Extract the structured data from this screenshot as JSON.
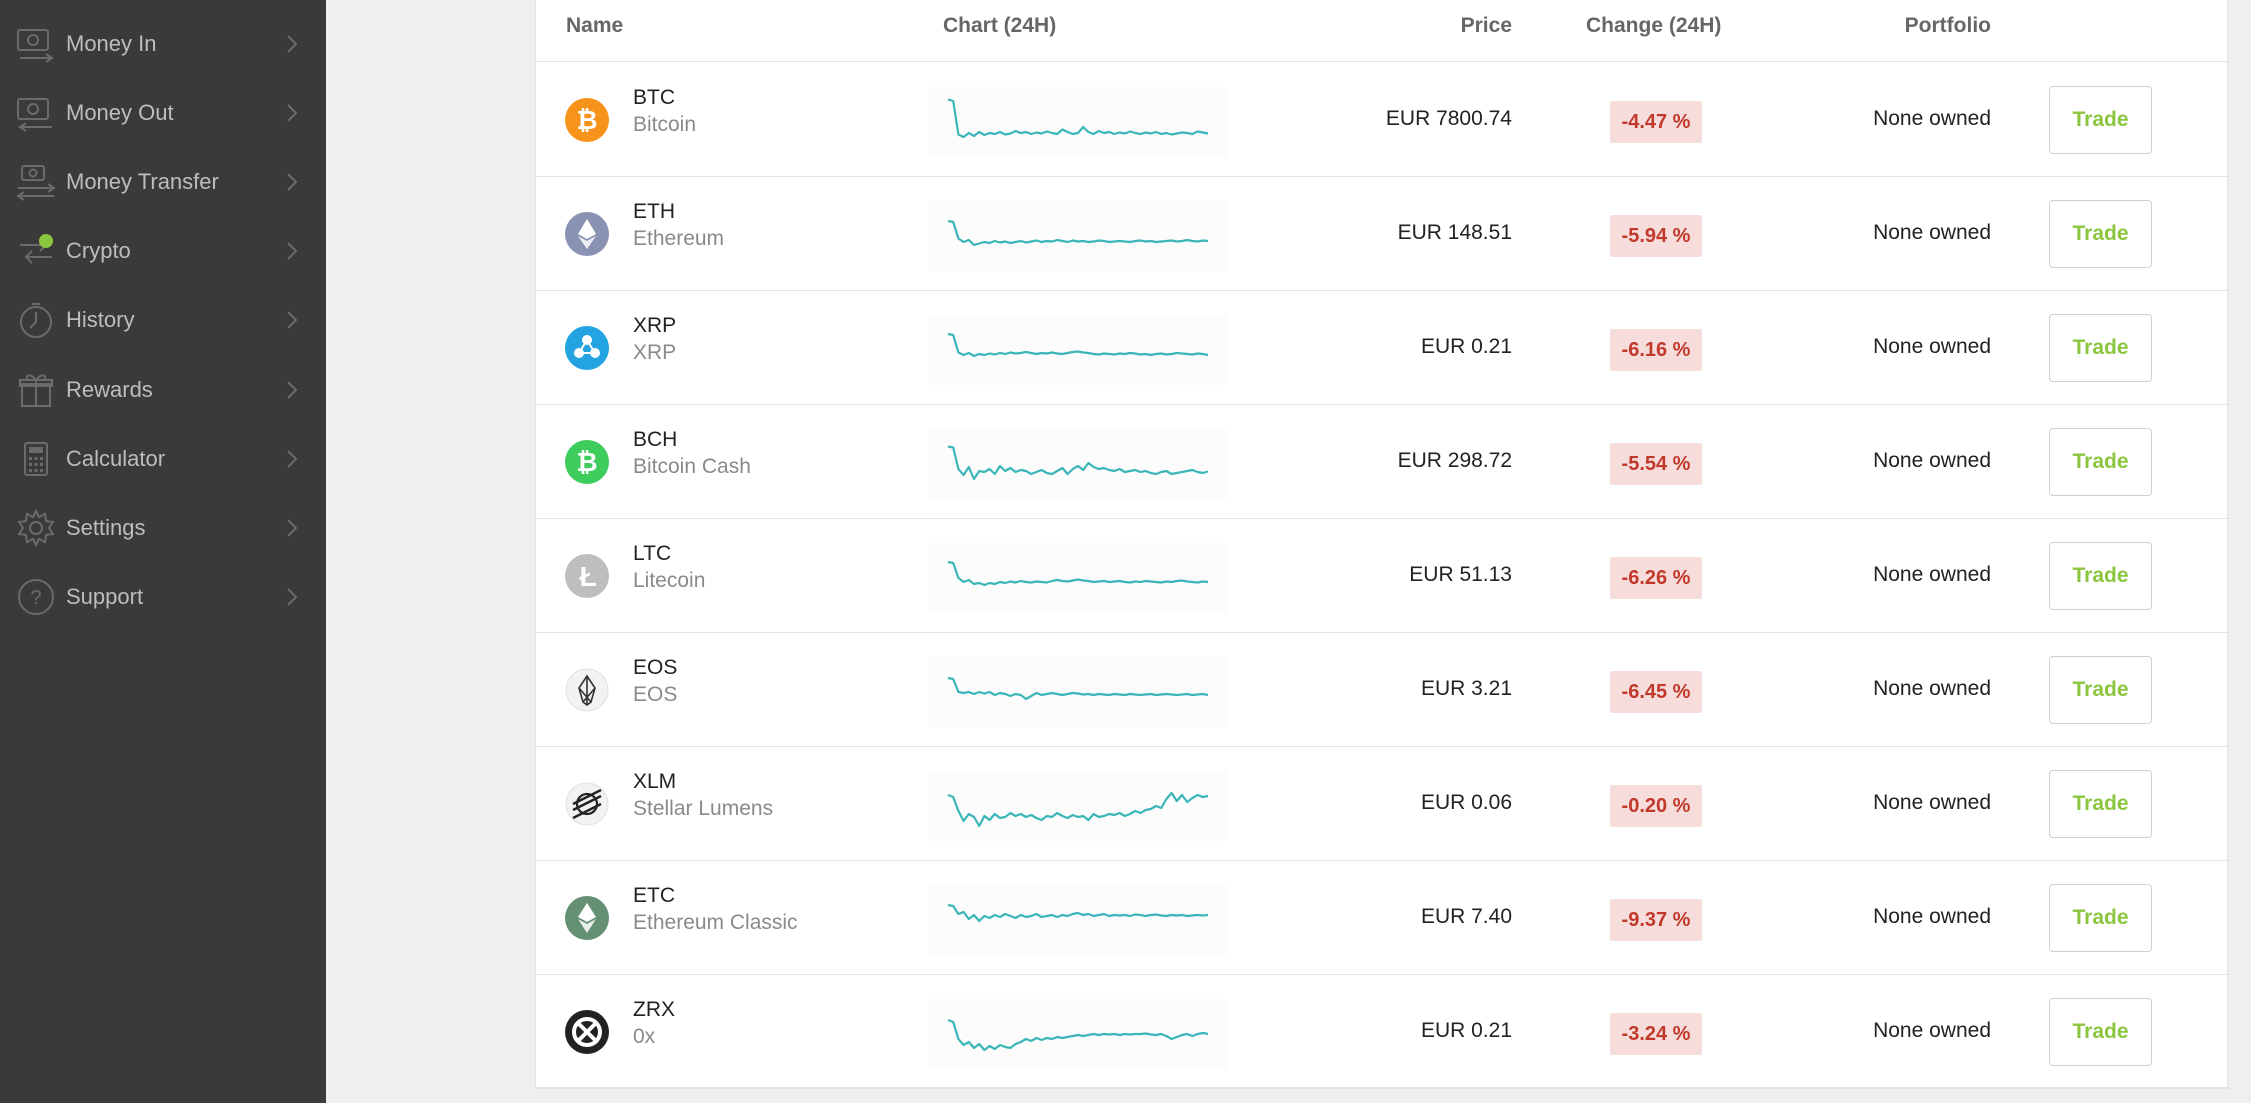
{
  "sidebar": {
    "items": [
      {
        "label": "Money In",
        "icon": "money-in-icon"
      },
      {
        "label": "Money Out",
        "icon": "money-out-icon"
      },
      {
        "label": "Money Transfer",
        "icon": "money-transfer-icon"
      },
      {
        "label": "Crypto",
        "icon": "crypto-icon",
        "badge_color": "#8cc63f"
      },
      {
        "label": "History",
        "icon": "history-icon"
      },
      {
        "label": "Rewards",
        "icon": "rewards-icon"
      },
      {
        "label": "Calculator",
        "icon": "calculator-icon"
      },
      {
        "label": "Settings",
        "icon": "settings-icon"
      },
      {
        "label": "Support",
        "icon": "support-icon"
      }
    ]
  },
  "table": {
    "headers": {
      "name": "Name",
      "chart": "Chart (24H)",
      "price": "Price",
      "change": "Change (24H)",
      "portfolio": "Portfolio"
    },
    "rows": [
      {
        "symbol": "BTC",
        "name": "Bitcoin",
        "price": "EUR 7800.74",
        "change": "-4.47 %",
        "portfolio": "None owned",
        "action": "Trade",
        "logo_color": "#f7931a",
        "logo_icon": "bitcoin-icon",
        "spark": [
          0.95,
          0.92,
          0.25,
          0.2,
          0.28,
          0.22,
          0.3,
          0.24,
          0.28,
          0.26,
          0.3,
          0.25,
          0.27,
          0.32,
          0.28,
          0.3,
          0.26,
          0.29,
          0.27,
          0.31,
          0.28,
          0.26,
          0.35,
          0.3,
          0.26,
          0.28,
          0.4,
          0.3,
          0.26,
          0.32,
          0.28,
          0.3,
          0.26,
          0.29,
          0.27,
          0.31,
          0.28,
          0.26,
          0.29,
          0.27,
          0.3,
          0.26,
          0.28,
          0.25,
          0.27,
          0.29,
          0.28,
          0.26,
          0.31,
          0.29,
          0.27
        ]
      },
      {
        "symbol": "ETH",
        "name": "Ethereum",
        "price": "EUR 148.51",
        "change": "-5.94 %",
        "portfolio": "None owned",
        "action": "Trade",
        "logo_color": "#8a92b2",
        "logo_icon": "ethereum-icon",
        "spark": [
          0.8,
          0.78,
          0.45,
          0.38,
          0.42,
          0.32,
          0.35,
          0.38,
          0.36,
          0.4,
          0.37,
          0.39,
          0.36,
          0.38,
          0.4,
          0.37,
          0.39,
          0.41,
          0.38,
          0.4,
          0.39,
          0.42,
          0.4,
          0.38,
          0.41,
          0.39,
          0.4,
          0.38,
          0.39,
          0.41,
          0.4,
          0.38,
          0.39,
          0.4,
          0.39,
          0.38,
          0.4,
          0.41,
          0.39,
          0.4,
          0.38,
          0.39,
          0.4,
          0.41,
          0.39,
          0.4,
          0.42,
          0.4,
          0.39,
          0.41,
          0.4
        ]
      },
      {
        "symbol": "XRP",
        "name": "XRP",
        "price": "EUR 0.21",
        "change": "-6.16 %",
        "portfolio": "None owned",
        "action": "Trade",
        "logo_color": "#23a3e0",
        "logo_icon": "xrp-icon",
        "spark": [
          0.82,
          0.8,
          0.45,
          0.4,
          0.44,
          0.38,
          0.42,
          0.4,
          0.43,
          0.41,
          0.44,
          0.42,
          0.45,
          0.43,
          0.44,
          0.46,
          0.44,
          0.42,
          0.44,
          0.43,
          0.45,
          0.43,
          0.42,
          0.44,
          0.46,
          0.47,
          0.45,
          0.44,
          0.42,
          0.41,
          0.43,
          0.42,
          0.41,
          0.43,
          0.42,
          0.44,
          0.43,
          0.41,
          0.42,
          0.4,
          0.42,
          0.43,
          0.41,
          0.42,
          0.44,
          0.43,
          0.42,
          0.41,
          0.43,
          0.42,
          0.4
        ]
      },
      {
        "symbol": "BCH",
        "name": "Bitcoin Cash",
        "price": "EUR 298.72",
        "change": "-5.54 %",
        "portfolio": "None owned",
        "action": "Trade",
        "logo_color": "#3ecc5c",
        "logo_icon": "bitcoin-cash-icon",
        "spark": [
          0.85,
          0.83,
          0.4,
          0.28,
          0.44,
          0.2,
          0.36,
          0.34,
          0.4,
          0.3,
          0.46,
          0.36,
          0.42,
          0.34,
          0.38,
          0.36,
          0.3,
          0.34,
          0.38,
          0.32,
          0.3,
          0.36,
          0.42,
          0.3,
          0.4,
          0.46,
          0.38,
          0.52,
          0.44,
          0.4,
          0.42,
          0.38,
          0.36,
          0.4,
          0.34,
          0.36,
          0.38,
          0.34,
          0.36,
          0.32,
          0.3,
          0.34,
          0.36,
          0.3,
          0.32,
          0.34,
          0.36,
          0.38,
          0.34,
          0.32,
          0.35
        ]
      },
      {
        "symbol": "LTC",
        "name": "Litecoin",
        "price": "EUR 51.13",
        "change": "-6.26 %",
        "portfolio": "None owned",
        "action": "Trade",
        "logo_color": "#bebebe",
        "logo_icon": "litecoin-icon",
        "spark": [
          0.82,
          0.8,
          0.5,
          0.42,
          0.46,
          0.38,
          0.4,
          0.36,
          0.4,
          0.38,
          0.42,
          0.4,
          0.43,
          0.41,
          0.44,
          0.42,
          0.41,
          0.43,
          0.42,
          0.41,
          0.44,
          0.46,
          0.44,
          0.43,
          0.45,
          0.47,
          0.45,
          0.44,
          0.42,
          0.43,
          0.44,
          0.42,
          0.43,
          0.44,
          0.42,
          0.41,
          0.43,
          0.42,
          0.44,
          0.43,
          0.42,
          0.41,
          0.43,
          0.42,
          0.44,
          0.45,
          0.43,
          0.42,
          0.41,
          0.43,
          0.42
        ]
      },
      {
        "symbol": "EOS",
        "name": "EOS",
        "price": "EUR 3.21",
        "change": "-6.45 %",
        "portfolio": "None owned",
        "action": "Trade",
        "logo_color": "#f2f2f2",
        "logo_icon": "eos-icon",
        "spark": [
          0.78,
          0.76,
          0.5,
          0.48,
          0.5,
          0.46,
          0.5,
          0.47,
          0.5,
          0.44,
          0.48,
          0.46,
          0.42,
          0.46,
          0.44,
          0.36,
          0.42,
          0.48,
          0.44,
          0.46,
          0.48,
          0.46,
          0.44,
          0.46,
          0.48,
          0.47,
          0.45,
          0.46,
          0.44,
          0.46,
          0.45,
          0.44,
          0.46,
          0.45,
          0.44,
          0.46,
          0.45,
          0.44,
          0.45,
          0.46,
          0.44,
          0.45,
          0.46,
          0.45,
          0.44,
          0.45,
          0.46,
          0.44,
          0.45,
          0.46,
          0.44
        ]
      },
      {
        "symbol": "XLM",
        "name": "Stellar Lumens",
        "price": "EUR 0.06",
        "change": "-0.20 %",
        "portfolio": "None owned",
        "action": "Trade",
        "logo_color": "#f2f2f2",
        "logo_icon": "stellar-icon",
        "spark": [
          0.72,
          0.68,
          0.4,
          0.2,
          0.34,
          0.28,
          0.1,
          0.3,
          0.22,
          0.34,
          0.26,
          0.28,
          0.36,
          0.3,
          0.34,
          0.28,
          0.32,
          0.26,
          0.22,
          0.3,
          0.28,
          0.36,
          0.3,
          0.26,
          0.32,
          0.28,
          0.3,
          0.22,
          0.34,
          0.28,
          0.3,
          0.34,
          0.32,
          0.36,
          0.3,
          0.34,
          0.4,
          0.36,
          0.42,
          0.44,
          0.5,
          0.46,
          0.64,
          0.76,
          0.6,
          0.72,
          0.58,
          0.66,
          0.72,
          0.68,
          0.7
        ]
      },
      {
        "symbol": "ETC",
        "name": "Ethereum Classic",
        "price": "EUR 7.40",
        "change": "-9.37 %",
        "portfolio": "None owned",
        "action": "Trade",
        "logo_color": "#669073",
        "logo_icon": "ethereum-classic-icon",
        "spark": [
          0.8,
          0.78,
          0.62,
          0.66,
          0.52,
          0.6,
          0.48,
          0.58,
          0.54,
          0.6,
          0.56,
          0.62,
          0.58,
          0.54,
          0.6,
          0.56,
          0.58,
          0.62,
          0.56,
          0.58,
          0.6,
          0.56,
          0.6,
          0.58,
          0.62,
          0.64,
          0.6,
          0.62,
          0.58,
          0.6,
          0.62,
          0.58,
          0.6,
          0.59,
          0.6,
          0.58,
          0.61,
          0.6,
          0.58,
          0.6,
          0.61,
          0.59,
          0.58,
          0.6,
          0.59,
          0.6,
          0.58,
          0.59,
          0.6,
          0.59,
          0.6
        ]
      },
      {
        "symbol": "ZRX",
        "name": "0x",
        "price": "EUR 0.21",
        "change": "-3.24 %",
        "portfolio": "None owned",
        "action": "Trade",
        "logo_color": "#222222",
        "logo_icon": "zrx-icon",
        "spark": [
          0.78,
          0.74,
          0.4,
          0.28,
          0.34,
          0.22,
          0.3,
          0.18,
          0.26,
          0.2,
          0.28,
          0.24,
          0.22,
          0.3,
          0.34,
          0.4,
          0.36,
          0.42,
          0.38,
          0.42,
          0.4,
          0.44,
          0.42,
          0.44,
          0.46,
          0.48,
          0.46,
          0.48,
          0.5,
          0.48,
          0.5,
          0.49,
          0.5,
          0.48,
          0.5,
          0.49,
          0.5,
          0.5,
          0.51,
          0.49,
          0.48,
          0.5,
          0.46,
          0.4,
          0.44,
          0.48,
          0.5,
          0.46,
          0.5,
          0.52,
          0.5
        ]
      }
    ]
  },
  "colors": {
    "sidebar_bg": "#3a3a3a",
    "sparkline": "#3bb6b8",
    "trade_text": "#8cc63f",
    "negative_badge_bg": "#f7dcdc",
    "negative_badge_text": "#c0392b"
  }
}
